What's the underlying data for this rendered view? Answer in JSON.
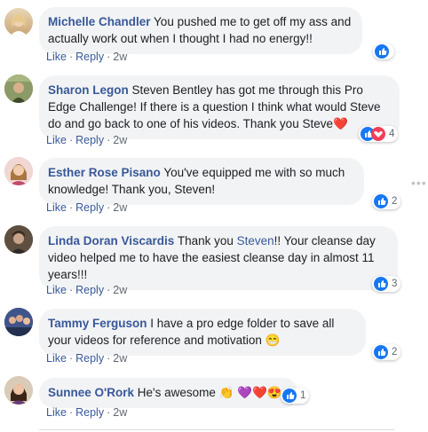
{
  "actions": {
    "like": "Like",
    "reply": "Reply",
    "dot": "·"
  },
  "comments": [
    {
      "name": "Michelle Chandler",
      "text": "You pushed me to get off my ass and actually work out when I thought I had no energy!!",
      "time": "2w",
      "reaction_count": ""
    },
    {
      "name": "Sharon Legon",
      "text": "Steven Bentley has got me through this Pro Edge Challenge! If there is a question I think what would Steve do and go back to one of his videos. Thank you Steve",
      "emoji": "❤️",
      "time": "2w",
      "reaction_count": "4"
    },
    {
      "name": "Esther Rose Pisano",
      "text": "You've equipped me with so much knowledge! Thank you, Steven!",
      "time": "2w",
      "reaction_count": "2"
    },
    {
      "name": "Linda Doran Viscardis",
      "text_before": "Thank you ",
      "mention": "Steven",
      "text_after": "!! Your cleanse day video helped me to have the easiest cleanse day in almost 11 years!!!",
      "time": "2w",
      "reaction_count": "3"
    },
    {
      "name": "Tammy Ferguson",
      "text": "I have a pro edge folder to save all your videos for reference and motivation",
      "emoji": "😁",
      "time": "2w",
      "reaction_count": "2"
    },
    {
      "name": "Sunnee O'Rork",
      "text": "He's awesome",
      "emoji": "👏 💜❤️😍",
      "time": "2w",
      "reaction_count": "1"
    }
  ],
  "colors": {
    "link": "#385898",
    "like": "#1877f2",
    "love": "#f33e58",
    "bubble": "#f2f3f5"
  }
}
